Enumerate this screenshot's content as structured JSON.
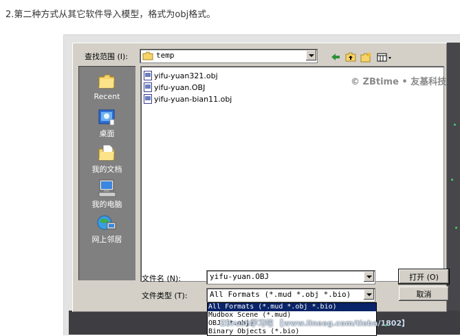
{
  "caption": "2.第二种方式从其它软件导入模型，格式为obj格式。",
  "dialog": {
    "look_in_label": "查找范围 (I):",
    "look_in_value": "temp",
    "places": [
      {
        "label": "Recent",
        "icon": "recent-folder-icon"
      },
      {
        "label": "桌面",
        "icon": "desktop-icon"
      },
      {
        "label": "我的文档",
        "icon": "my-documents-icon"
      },
      {
        "label": "我的电脑",
        "icon": "my-computer-icon"
      },
      {
        "label": "网上邻居",
        "icon": "network-places-icon"
      }
    ],
    "files": [
      "yifu-yuan321.obj",
      "yifu-yuan.OBJ",
      "yifu-yuan-bian11.obj"
    ],
    "filename_label": "文件名 (N):",
    "filename_value": "yifu-yuan.OBJ",
    "filetype_label": "文件类型 (T):",
    "filetype_value": "All Formats (*.mud *.obj *.bio)",
    "open_button": "打开 (O)",
    "cancel_button": "取消",
    "filetype_options": [
      "All Formats (*.mud *.obj *.bio)",
      "Mudbox Scene (*.mud)",
      "OBJ (*.obj)",
      "Binary Objects (*.bio)"
    ],
    "selected_option_index": 0
  },
  "watermark": "© ZBtime • 友基科技",
  "forum_watermark": "ZBrush学习吧 【www.lineeg.com/tieba/1802】",
  "colors": {
    "dialog_bg": "#d4d0c8",
    "places_bg": "#808080",
    "selection": "#0a246a"
  }
}
